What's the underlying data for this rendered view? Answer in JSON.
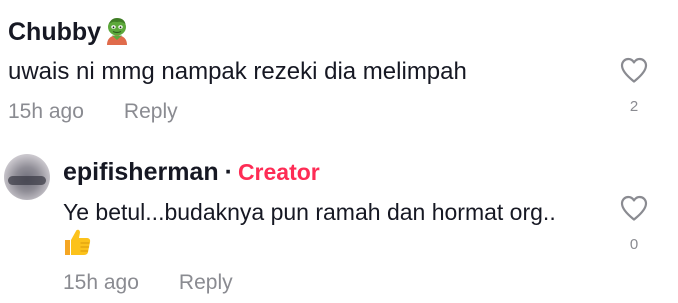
{
  "comments": [
    {
      "username": "Chubby",
      "emoji": "zombie-emoji",
      "text": "uwais ni mmg nampak rezeki dia melimpah",
      "time": "15h ago",
      "reply_label": "Reply",
      "like_count": "2",
      "like_icon": "heart-outline-icon"
    },
    {
      "username": "epifisherman",
      "separator": "·",
      "badge": "Creator",
      "badge_color": "#fe2c55",
      "text": "Ye betul...budaknya pun ramah dan hormat org..",
      "emoji": "thumbs-up-emoji",
      "time": "15h ago",
      "reply_label": "Reply",
      "like_count": "0",
      "like_icon": "heart-outline-icon"
    }
  ],
  "colors": {
    "text_primary": "#161823",
    "text_secondary": "#8a8b91",
    "creator_accent": "#fe2c55"
  }
}
